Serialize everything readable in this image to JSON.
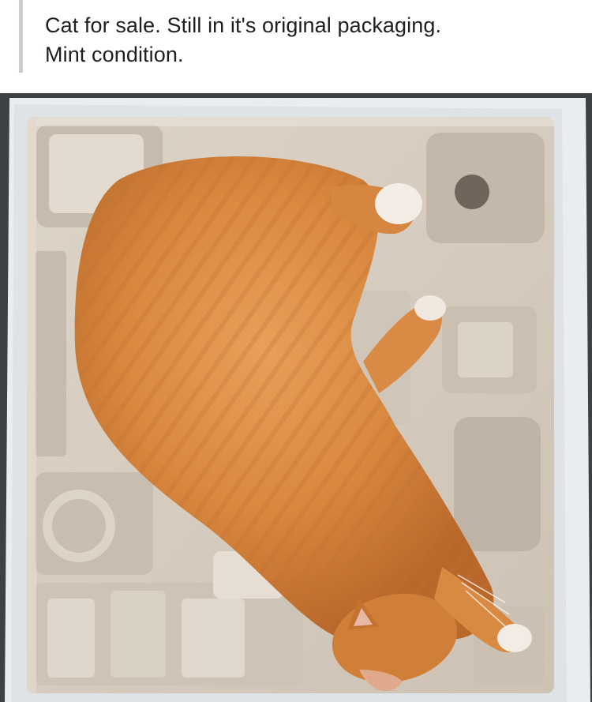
{
  "post": {
    "text_lines": [
      "Cat for sale. Still in it's original packaging.",
      "Mint condition."
    ]
  },
  "photo": {
    "subject": "orange-tabby-cat-curled-in-cardboard-packaging",
    "colors": {
      "cat_fur": "#d9883f",
      "cat_white": "#f3ede6",
      "pulp_tray": "#d6ccbf",
      "box_edge": "#e8ecef"
    }
  }
}
